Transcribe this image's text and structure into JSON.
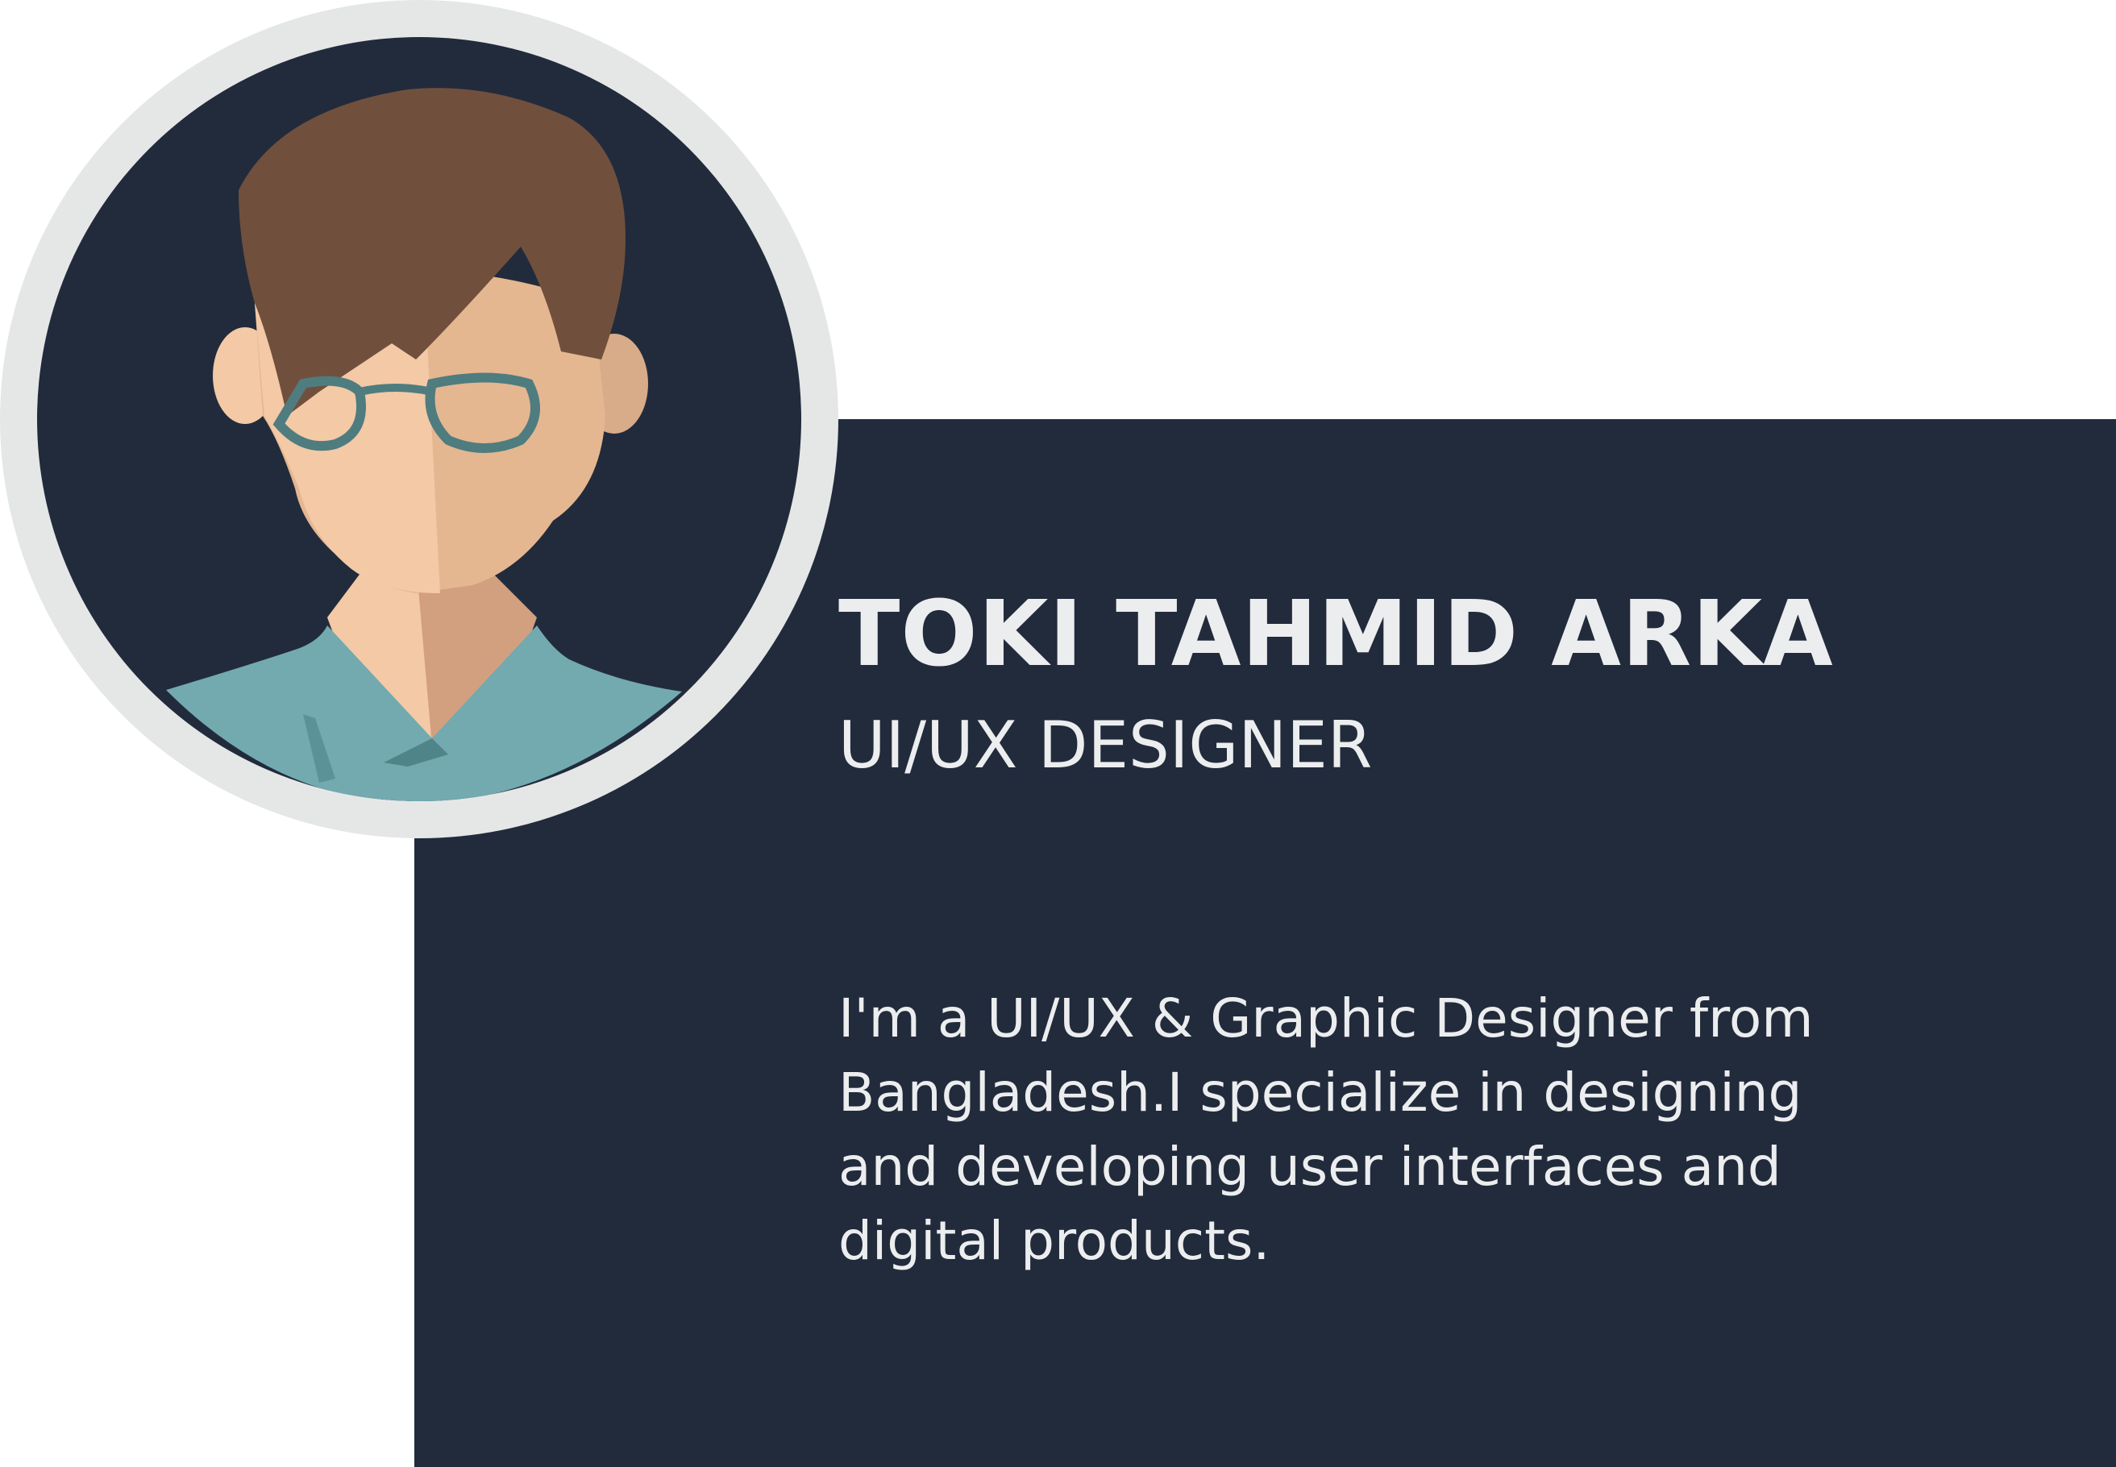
{
  "profile": {
    "name": "TOKI TAHMID ARKA",
    "role": "UI/UX DESIGNER",
    "bio": "I'm a UI/UX & Graphic Designer from\nBangladesh.I specialize in designing\nand developing user interfaces and\ndigital products."
  },
  "avatar": {
    "icon": "person-avatar-icon",
    "ring_color": "#e5e7e7",
    "background_color": "#222b3c"
  },
  "colors": {
    "panel": "#222b3c",
    "page_background": "#ffffff",
    "text": "#ecedee"
  }
}
